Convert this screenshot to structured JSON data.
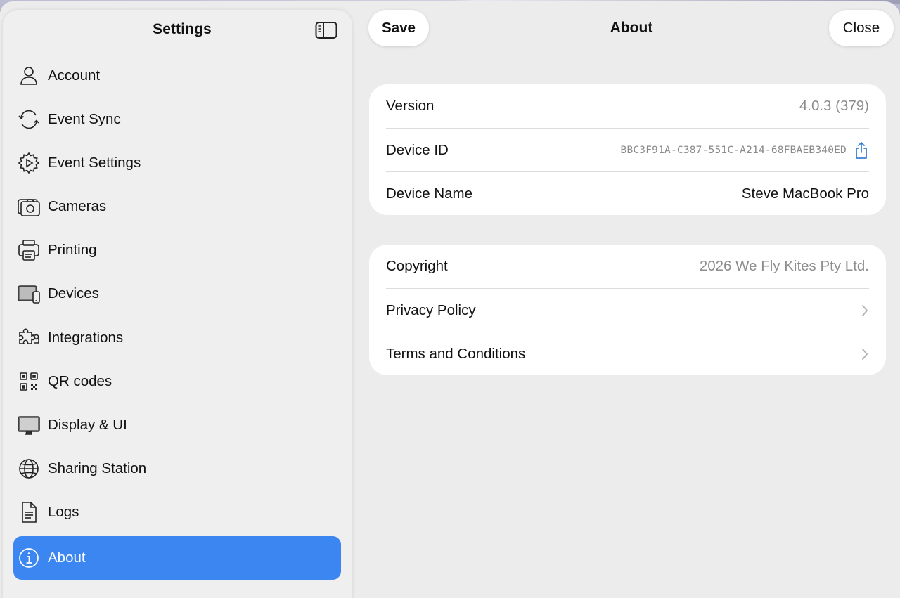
{
  "sidebar": {
    "title": "Settings",
    "items": [
      {
        "label": "Account",
        "icon": "person-icon"
      },
      {
        "label": "Event Sync",
        "icon": "sync-icon"
      },
      {
        "label": "Event Settings",
        "icon": "gear-play-icon"
      },
      {
        "label": "Cameras",
        "icon": "camera-icon"
      },
      {
        "label": "Printing",
        "icon": "printer-icon"
      },
      {
        "label": "Devices",
        "icon": "devices-icon"
      },
      {
        "label": "Integrations",
        "icon": "puzzle-icon"
      },
      {
        "label": "QR codes",
        "icon": "qrcode-icon"
      },
      {
        "label": "Display & UI",
        "icon": "display-icon"
      },
      {
        "label": "Sharing Station",
        "icon": "globe-icon"
      },
      {
        "label": "Logs",
        "icon": "document-icon"
      },
      {
        "label": "About",
        "icon": "info-icon"
      }
    ],
    "selected": "About"
  },
  "header": {
    "save_label": "Save",
    "title": "About",
    "close_label": "Close"
  },
  "info": {
    "version_label": "Version",
    "version_value": "4.0.3 (379)",
    "device_id_label": "Device ID",
    "device_id_value": "BBC3F91A-C387-551C-A214-68FBAEB340ED",
    "device_name_label": "Device Name",
    "device_name_value": "Steve MacBook Pro"
  },
  "legal": {
    "copyright_label": "Copyright",
    "copyright_value": "2026 We Fly Kites Pty Ltd.",
    "privacy_label": "Privacy Policy",
    "terms_label": "Terms and Conditions"
  },
  "colors": {
    "accent": "#3b86f0",
    "share_icon": "#3b7fd6"
  }
}
